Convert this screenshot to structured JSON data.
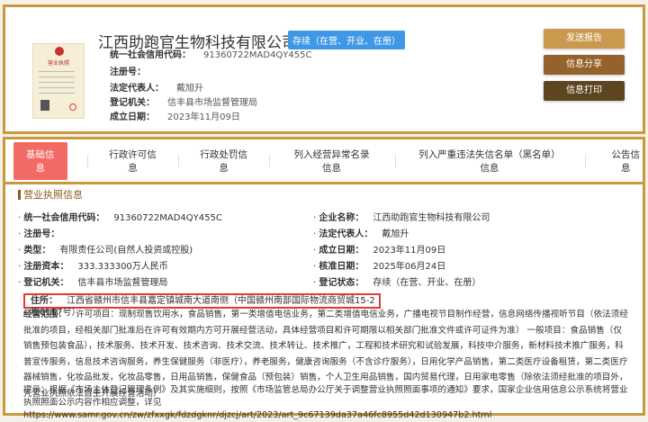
{
  "header": {
    "company_name": "江西助跑官生物科技有限公司",
    "status_badge": "存续（在营、开业、在册）",
    "license_image_title": "营业执照",
    "fields": [
      {
        "label": "统一社会信用代码：",
        "value": "91360722MAD4QY455C"
      },
      {
        "label": "注册号：",
        "value": ""
      },
      {
        "label": "法定代表人：",
        "value": "戴旭升"
      },
      {
        "label": "登记机关：",
        "value": "信丰县市场监督管理局"
      },
      {
        "label": "成立日期：",
        "value": "2023年11月09日"
      }
    ],
    "buttons": [
      {
        "label": "发送报告",
        "color": "#c99a4e"
      },
      {
        "label": "信息分享",
        "color": "#94622a"
      },
      {
        "label": "信息打印",
        "color": "#5e4522"
      }
    ]
  },
  "tabs": [
    {
      "label": "基础信息",
      "active": true
    },
    {
      "label": "行政许可信息"
    },
    {
      "label": "行政处罚信息"
    },
    {
      "label": "列入经营异常名录信息"
    },
    {
      "label": "列入严重违法失信名单（黑名单）信息"
    },
    {
      "label": "公告信息"
    }
  ],
  "section_title": "营业执照信息",
  "info_left": [
    {
      "label": "统一社会信用代码：",
      "value": "91360722MAD4QY455C"
    },
    {
      "label": "注册号：",
      "value": ""
    },
    {
      "label": "类型：",
      "value": "有限责任公司(自然人投资或控股)"
    },
    {
      "label": "注册资本：",
      "value": "333.333300万人民币"
    },
    {
      "label": "登记机关：",
      "value": "信丰县市场监督管理局"
    }
  ],
  "info_right": [
    {
      "label": "企业名称：",
      "value": "江西助跑官生物科技有限公司"
    },
    {
      "label": "法定代表人：",
      "value": "戴旭升"
    },
    {
      "label": "成立日期：",
      "value": "2023年11月09日"
    },
    {
      "label": "核准日期：",
      "value": "2025年06月24日"
    },
    {
      "label": "登记状态：",
      "value": "存续（在营、开业、在册）"
    }
  ],
  "address": {
    "label": "住所：",
    "value": "江西省赣州市信丰县嘉定镇城南大道南侧（中国赣州南部国际物流商贸城15-2栋0157号）"
  },
  "scope": {
    "label": "经营范围：",
    "value": "许可项目：现制现售饮用水，食品销售，第一类增值电信业务，第二类增值电信业务，广播电视节目制作经营，信息网络传播视听节目（依法须经批准的项目，经相关部门批准后在许可有效期内方可开展经营活动，具体经营项目和许可期限以相关部门批准文件或许可证件为准） 一般项目：食品销售（仅销售预包装食品），技术服务、技术开发、技术咨询、技术交流、技术转让、技术推广，工程和技术研究和试验发展，科技中介服务，新材料技术推广服务，科普宣传服务，信息技术咨询服务，养生保健服务（非医疗），养老服务，健康咨询服务（不含诊疗服务），日用化学产品销售，第二类医疗设备租赁，第二类医疗器械销售，化妆品批发，化妆品零售，日用品销售，保健食品（预包装）销售，个人卫生用品销售，国内贸易代理，日用家电零售（除依法须经批准的项目外，凭营业执照依法自主开展经营活动）"
  },
  "tip": "提示：根据《市场主体登记管理条例》及其实施细则，按照《市场监管总局办公厅关于调整营业执照照面事项的通知》要求，国家企业信用信息公示系统将营业执照照面公示内容作相应调整，详见https://www.samr.gov.cn/zw/zfxxgk/fdzdgknr/djzcj/art/2023/art_9c67139da37a46fc8955d42d130947b2.html"
}
